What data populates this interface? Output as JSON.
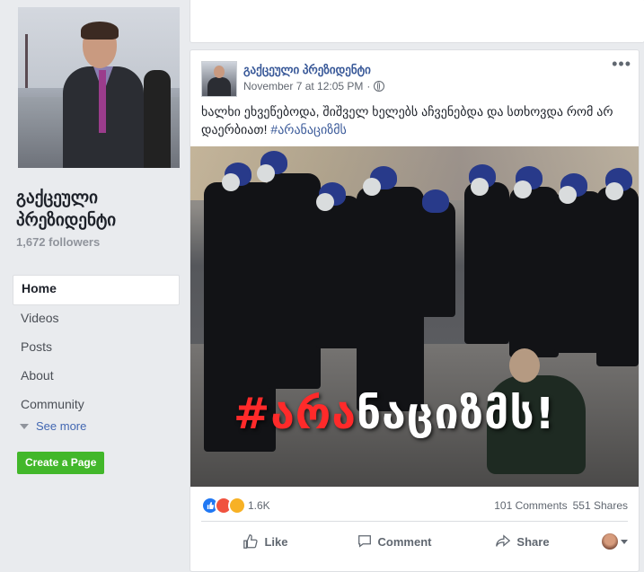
{
  "sidebar": {
    "page_name": "გაქცეული პრეზიდენტი",
    "followers": "1,672 followers",
    "nav": [
      "Home",
      "Videos",
      "Posts",
      "About",
      "Community"
    ],
    "see_more": "See more",
    "create_page": "Create a Page"
  },
  "post": {
    "author": "გაქცეული პრეზიდენტი",
    "timestamp": "November 7 at 12:05 PM",
    "privacy_icon": "globe-icon",
    "text": "ხალხი ეხვეწებოდა, შიშველ ხელებს აჩვენებდა და სთხოვდა რომ არ დაერბიათ! ",
    "hashtag": "#არანაციზმს",
    "photo_slogan_red": "#არა",
    "photo_slogan_white": "ნაციზმს!",
    "reaction_count": "1.6K",
    "comments": "101 Comments",
    "shares": "551 Shares",
    "actions": {
      "like": "Like",
      "comment": "Comment",
      "share": "Share"
    }
  },
  "colors": {
    "link_blue": "#385898",
    "create_green": "#42b72a",
    "slogan_red": "#ff2a2a"
  }
}
